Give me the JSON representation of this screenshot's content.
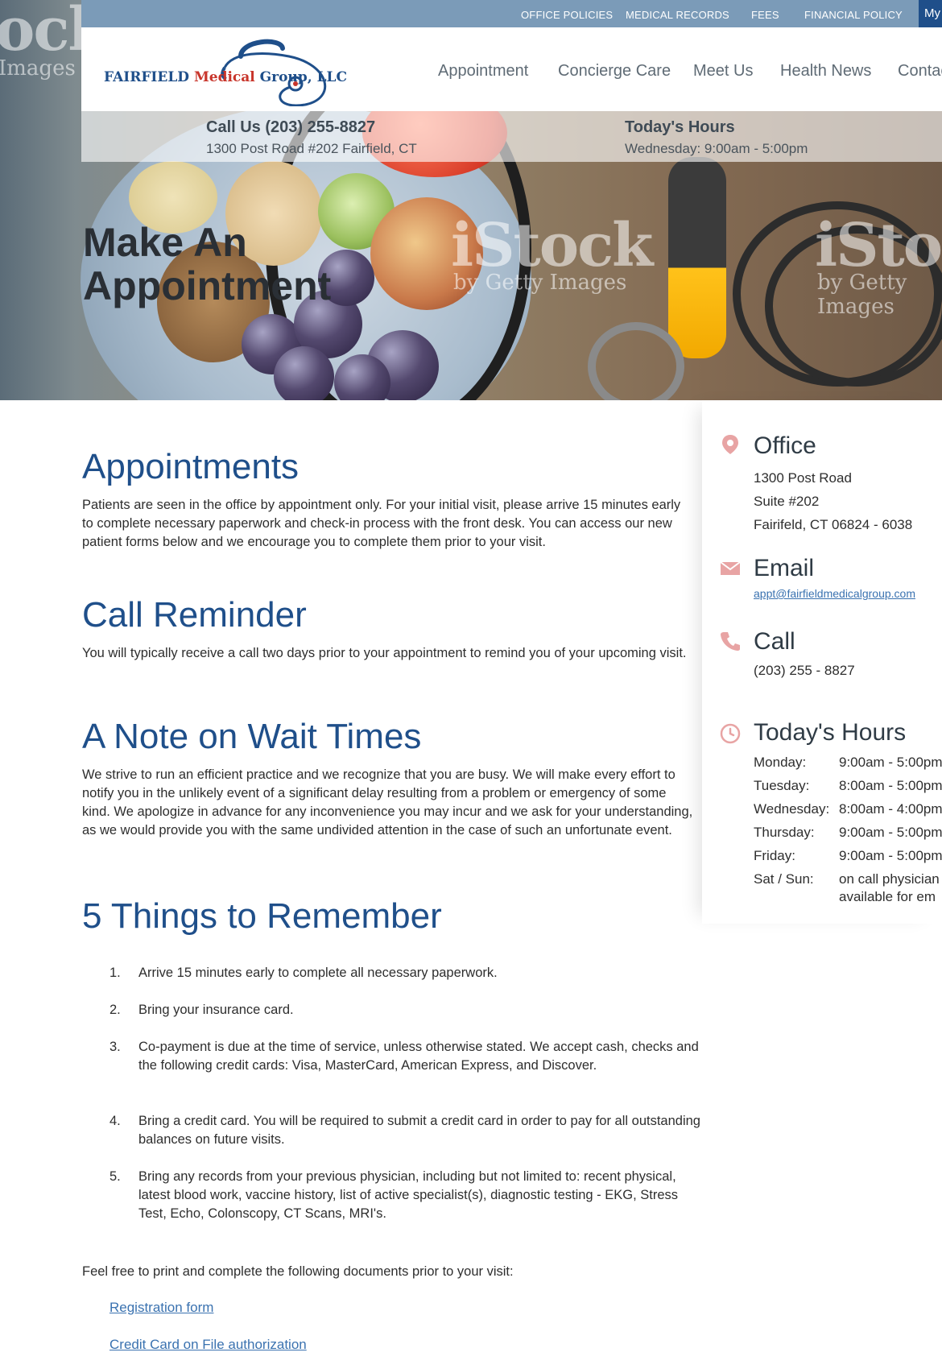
{
  "utility_nav": {
    "items": [
      "OFFICE POLICIES",
      "MEDICAL RECORDS",
      "FEES",
      "FINANCIAL POLICY"
    ],
    "my_button": "My"
  },
  "logo": {
    "name_blue": "FAIRFIELD ",
    "name_red": "Medical",
    "name_rest": " Group, LLC"
  },
  "main_nav": {
    "items": [
      "Appointment",
      "Concierge Care",
      "Meet Us",
      "Health News",
      "Contac"
    ]
  },
  "info_strip": {
    "call_title": "Call Us (203) 255-8827",
    "address": "1300 Post Road #202 Fairfield, CT",
    "hours_title": "Today's Hours",
    "hours_value": "Wednesday: 9:00am - 5:00pm"
  },
  "hero": {
    "title_line1": "Make An",
    "title_line2": "Appointment",
    "watermark_big": "iStock",
    "watermark_small": "by Getty Images",
    "watermark_edge_big": "ock",
    "watermark_edge_small": "Images"
  },
  "main": {
    "appointments": {
      "heading": "Appointments",
      "body": "Patients are seen in the office by appointment only. For your initial visit, please arrive 15 minutes early to complete necessary paperwork and check-in process with the front desk. You can access our new patient forms below and we encourage you to complete them prior to your visit."
    },
    "call_reminder": {
      "heading": "Call Reminder",
      "body": "You will typically receive a call two days prior to your appointment to remind you of your upcoming visit."
    },
    "wait_times": {
      "heading": "A Note on Wait Times",
      "body": "We strive to run an efficient practice and we recognize that you are busy. We will make every effort to notify you in the unlikely event of a significant delay resulting from a problem or emergency of some kind. We apologize in advance for any inconvenience you may incur and we ask for your understanding, as we would provide you with the same undivided attention in the case of such an unfortunate event."
    },
    "five_things": {
      "heading": "5 Things to Remember",
      "items": [
        {
          "num": "1.",
          "text": "Arrive 15 minutes early to complete all necessary paperwork."
        },
        {
          "num": "2.",
          "text": "Bring your insurance card."
        },
        {
          "num": "3.",
          "text": "Co-payment is due at the time of service, unless otherwise stated. We accept cash, checks and the following credit cards: Visa, MasterCard, American Express, and Discover."
        },
        {
          "num": "4.",
          "text": "Bring a credit card. You will be required to submit a credit card in order to pay for all outstanding balances on future visits."
        },
        {
          "num": "5.",
          "text": "Bring any records from your previous physician, including but not limited to: recent physical, latest blood work, vaccine history, list of active specialist(s),  diagnostic testing - EKG, Stress Test, Echo, Colonscopy, CT Scans, MRI's."
        }
      ]
    },
    "documents": {
      "intro": "Feel free to print and complete the following documents prior to your visit:",
      "links": [
        "Registration form",
        "Credit Card on File authorization"
      ]
    }
  },
  "sidebar": {
    "office": {
      "title": "Office",
      "lines": [
        "1300 Post Road",
        "Suite #202",
        "Fairifeld, CT 06824 - 6038"
      ]
    },
    "email": {
      "title": "Email",
      "address": "appt@fairfieldmedicalgroup.com"
    },
    "call": {
      "title": "Call",
      "number": "(203) 255 - 8827"
    },
    "hours": {
      "title": "Today's Hours",
      "rows": [
        {
          "day": "Monday:",
          "time": "9:00am - 5:00pm"
        },
        {
          "day": "Tuesday:",
          "time": "8:00am - 5:00pm"
        },
        {
          "day": "Wednesday:",
          "time": "8:00am - 4:00pm"
        },
        {
          "day": "Thursday:",
          "time": "9:00am - 5:00pm"
        },
        {
          "day": "Friday:",
          "time": "9:00am - 5:00pm"
        },
        {
          "day": "Sat / Sun:",
          "time": "on call physician",
          "time2": "available for em"
        }
      ]
    },
    "icon_color": "#e8a4a4"
  },
  "colors": {
    "brand_blue": "#1f4f8a",
    "link_blue": "#3a72b0",
    "utility_bar": "#7b9bb8",
    "logo_red": "#c8352b"
  }
}
